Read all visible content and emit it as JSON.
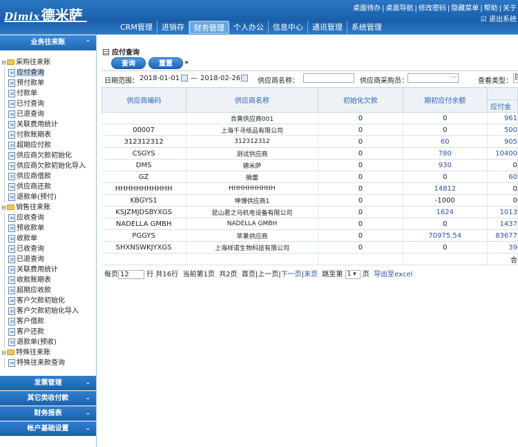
{
  "header": {
    "logo_en": "Dimix",
    "logo_cn": "德米萨",
    "top_links": [
      "桌面待办",
      "桌面导航",
      "修改密码",
      "隐藏菜单",
      "帮助",
      "关于"
    ],
    "logout": "退出系统",
    "nav": [
      "CRM管理",
      "进销存",
      "财务管理",
      "个人办公",
      "信息中心",
      "通讯管理",
      "系统管理"
    ]
  },
  "sidebar": {
    "title": "业务往来账",
    "groups": [
      {
        "label": "采购往来账",
        "items": [
          "应付查询",
          "预付款单",
          "付款单",
          "已付查询",
          "已退查询",
          "关联费用统计",
          "付款账期表",
          "超期应付款",
          "供应商欠款初始化",
          "供应商欠款初始化导入",
          "供应商借款",
          "供应商还款",
          "退款单(预付)"
        ]
      },
      {
        "label": "销售往来账",
        "items": [
          "应收查询",
          "预收款单",
          "收款单",
          "已收查询",
          "已退查询",
          "关联费用统计",
          "收款账期表",
          "超期应收款",
          "客户欠款初始化",
          "客户欠款初始化导入",
          "客户借款",
          "客户还款",
          "退款单(预收)"
        ]
      },
      {
        "label": "特殊往来账",
        "items": [
          "特殊往来款查询"
        ]
      }
    ],
    "bottom_sections": [
      "发票管理",
      "其它类收付款",
      "财务报表",
      "帐户基础设置"
    ]
  },
  "main": {
    "title": "应付查询",
    "buttons": {
      "query": "查询",
      "reset": "重置"
    },
    "filter": {
      "date_label": "日期范围：",
      "date_from": "2018-01-01",
      "date_sep": "—",
      "date_to": "2018-02-26",
      "supplier_label": "供应商名称：",
      "buyer_label": "供应商采购员：",
      "view_label": "查看类型：",
      "view_value": "应"
    },
    "table": {
      "columns": [
        "供应商编码",
        "供应商名称",
        "初始化欠款",
        "期初应付余额",
        "应付"
      ],
      "sub_column": "应付金",
      "rows": [
        [
          "",
          "合黄供应商001",
          "0",
          "0",
          "961"
        ],
        [
          "00007",
          "上海千寻纸品有限公司",
          "0",
          "0",
          "500"
        ],
        [
          "312312312",
          "312312312",
          "0",
          "60",
          "905"
        ],
        [
          "CSGYS",
          "测试供应商",
          "0",
          "780",
          "10400"
        ],
        [
          "DMS",
          "德米萨",
          "0",
          "930",
          "0"
        ],
        [
          "GZ",
          "摘蕾",
          "0",
          "0",
          "60"
        ],
        [
          "HHHHHHHHHHH",
          "HHHHHHHHHH",
          "0",
          "14812",
          "0"
        ],
        [
          "KBGYS1",
          "坤博供应商1",
          "0",
          "-1000",
          "0"
        ],
        [
          "KSJZMJDSBYXGS",
          "昆山君之马机电设备有限公司",
          "0",
          "1624",
          "1013"
        ],
        [
          "NADELLA GMBH",
          "NADELLA GMBH",
          "0",
          "0",
          "1437"
        ],
        [
          "PGGYS",
          "苹果供应商",
          "0",
          "70975.54",
          "83677"
        ],
        [
          "SHXNSWKJYXGS",
          "上海祥诺生物科技有限公司",
          "0",
          "0",
          "39"
        ]
      ],
      "total_label": "合"
    },
    "pager": {
      "per_page_label": "每页",
      "per_page_value": "12",
      "rows_info": "行 共16行",
      "current": "当前第1页",
      "total_pages": "共2页",
      "first": "首页",
      "prev": "上一页",
      "next": "下一页",
      "last": "末页",
      "jump_label": "跳至第",
      "jump_value": "1",
      "page_unit": "页",
      "export": "导出至excel"
    }
  }
}
